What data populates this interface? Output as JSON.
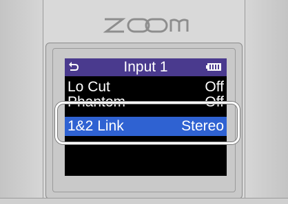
{
  "device": {
    "brand_logo": "zoom",
    "colors": {
      "body": "#d9d9d9",
      "screen_bg": "#000000",
      "titlebar": "#4a3a8e",
      "selection": "#2f62d2",
      "highlight_frame": "#ffffff"
    }
  },
  "screen": {
    "header": {
      "back_icon": "back-arrow-icon",
      "title": "Input 1",
      "battery_icon": "battery-icon"
    },
    "rows": [
      {
        "label": "Lo Cut",
        "value": "Off",
        "selected": false
      },
      {
        "label": "Phantom",
        "value": "Off",
        "selected": false
      },
      {
        "label": "1&2 Link",
        "value": "Stereo",
        "selected": true
      }
    ]
  }
}
